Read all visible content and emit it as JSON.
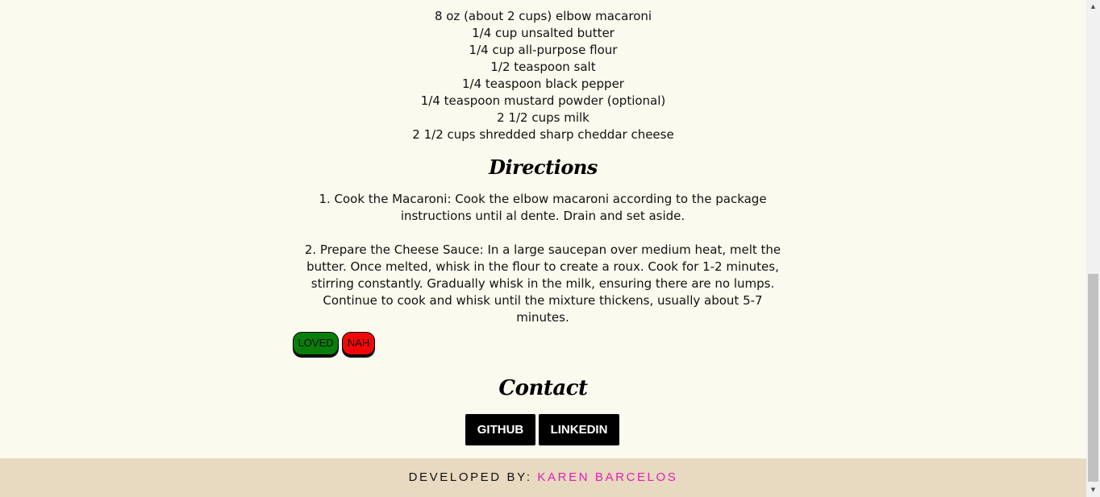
{
  "ingredients": [
    "8 oz (about 2 cups) elbow macaroni",
    "1/4 cup unsalted butter",
    "1/4 cup all-purpose flour",
    "1/2 teaspoon salt",
    "1/4 teaspoon black pepper",
    "1/4 teaspoon mustard powder (optional)",
    "2 1/2 cups milk",
    "2 1/2 cups shredded sharp cheddar cheese"
  ],
  "directions": {
    "title": "Directions",
    "steps": [
      "1. Cook the Macaroni: Cook the elbow macaroni according to the package instructions until al dente. Drain and set aside.",
      "2. Prepare the Cheese Sauce: In a large saucepan over medium heat, melt the butter. Once melted, whisk in the flour to create a roux. Cook for 1-2 minutes, stirring constantly. Gradually whisk in the milk, ensuring there are no lumps. Continue to cook and whisk until the mixture thickens, usually about 5-7 minutes."
    ]
  },
  "vote": {
    "loved_label": "LOVED",
    "nah_label": "NAH"
  },
  "contact": {
    "title": "Contact",
    "github_label": "GITHUB",
    "linkedin_label": "LINKEDIN"
  },
  "footer": {
    "prefix": "DEVELOPED BY: ",
    "name": "KAREN BARCELOS"
  },
  "colors": {
    "background": "#fbfaee",
    "footer_bg": "#e8d9c1",
    "footer_name": "#e020b5",
    "loved_bg": "#0a7d0a",
    "nah_bg": "#f10808"
  },
  "scrollbar": {
    "up_icon": "arrow-up-icon",
    "down_icon": "arrow-down-icon"
  }
}
